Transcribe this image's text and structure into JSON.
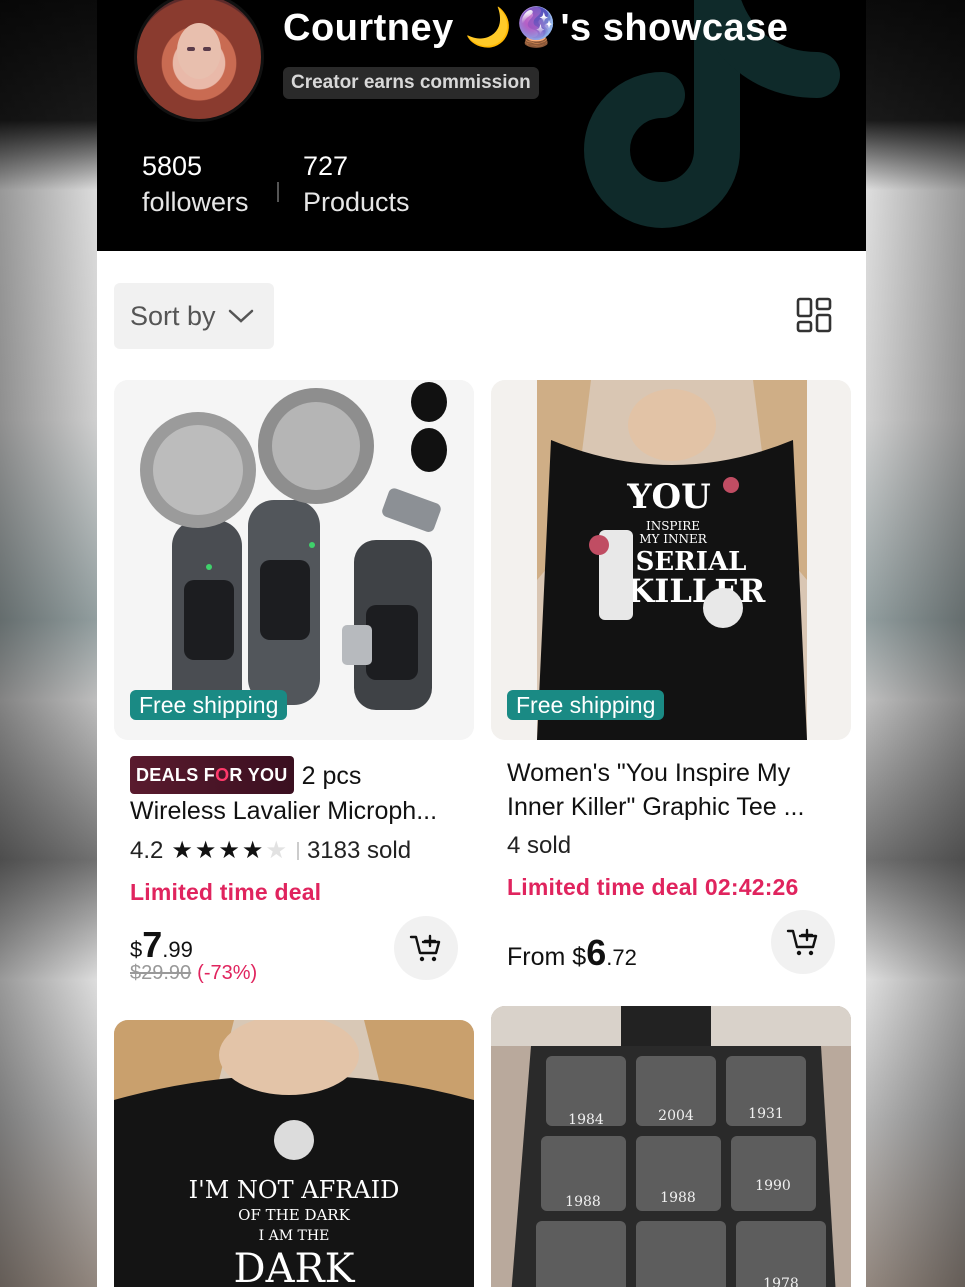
{
  "header": {
    "title": "Courtney 🌙🔮's showcase",
    "commission_badge": "Creator earns commission",
    "followers_count": "5805",
    "followers_label": "followers",
    "products_count": "727",
    "products_label": "Products"
  },
  "toolbar": {
    "sort_label": "Sort by",
    "layout_icon": "grid-layout-icon"
  },
  "products": [
    {
      "free_shipping": "Free shipping",
      "deals_badge_a": "DEALS F",
      "deals_badge_o": "O",
      "deals_badge_b": "R YOU",
      "title_line1": "2 pcs",
      "title_line2": "Wireless Lavalier Microph...",
      "rating": "4.2",
      "stars_filled": "★★★★",
      "stars_empty": "★",
      "sold": "3183 sold",
      "deal_text": "Limited time deal",
      "currency": "$",
      "price_int": "7",
      "price_dec": ".99",
      "original_price": "$29.90",
      "discount": "(-73%)"
    },
    {
      "free_shipping": "Free shipping",
      "title_line1": "Women's \"You Inspire My",
      "title_line2": "Inner Killer\" Graphic Tee ...",
      "sold": "4 sold",
      "deal_text": "Limited time deal 02:42:26",
      "price_prefix": "From $",
      "price_int": "6",
      "price_dec": ".72"
    },
    {
      "shirt_text_1": "I'M NOT AFRAID",
      "shirt_text_2": "OF THE DARK",
      "shirt_text_3": "I AM THE",
      "shirt_text_4": "DARK"
    },
    {
      "years": [
        "1984",
        "2004",
        "1931",
        "1988",
        "1988",
        "1990",
        "1978"
      ]
    }
  ],
  "colors": {
    "accent_pink": "#e0245e",
    "free_ship_teal": "#1a8a84"
  }
}
